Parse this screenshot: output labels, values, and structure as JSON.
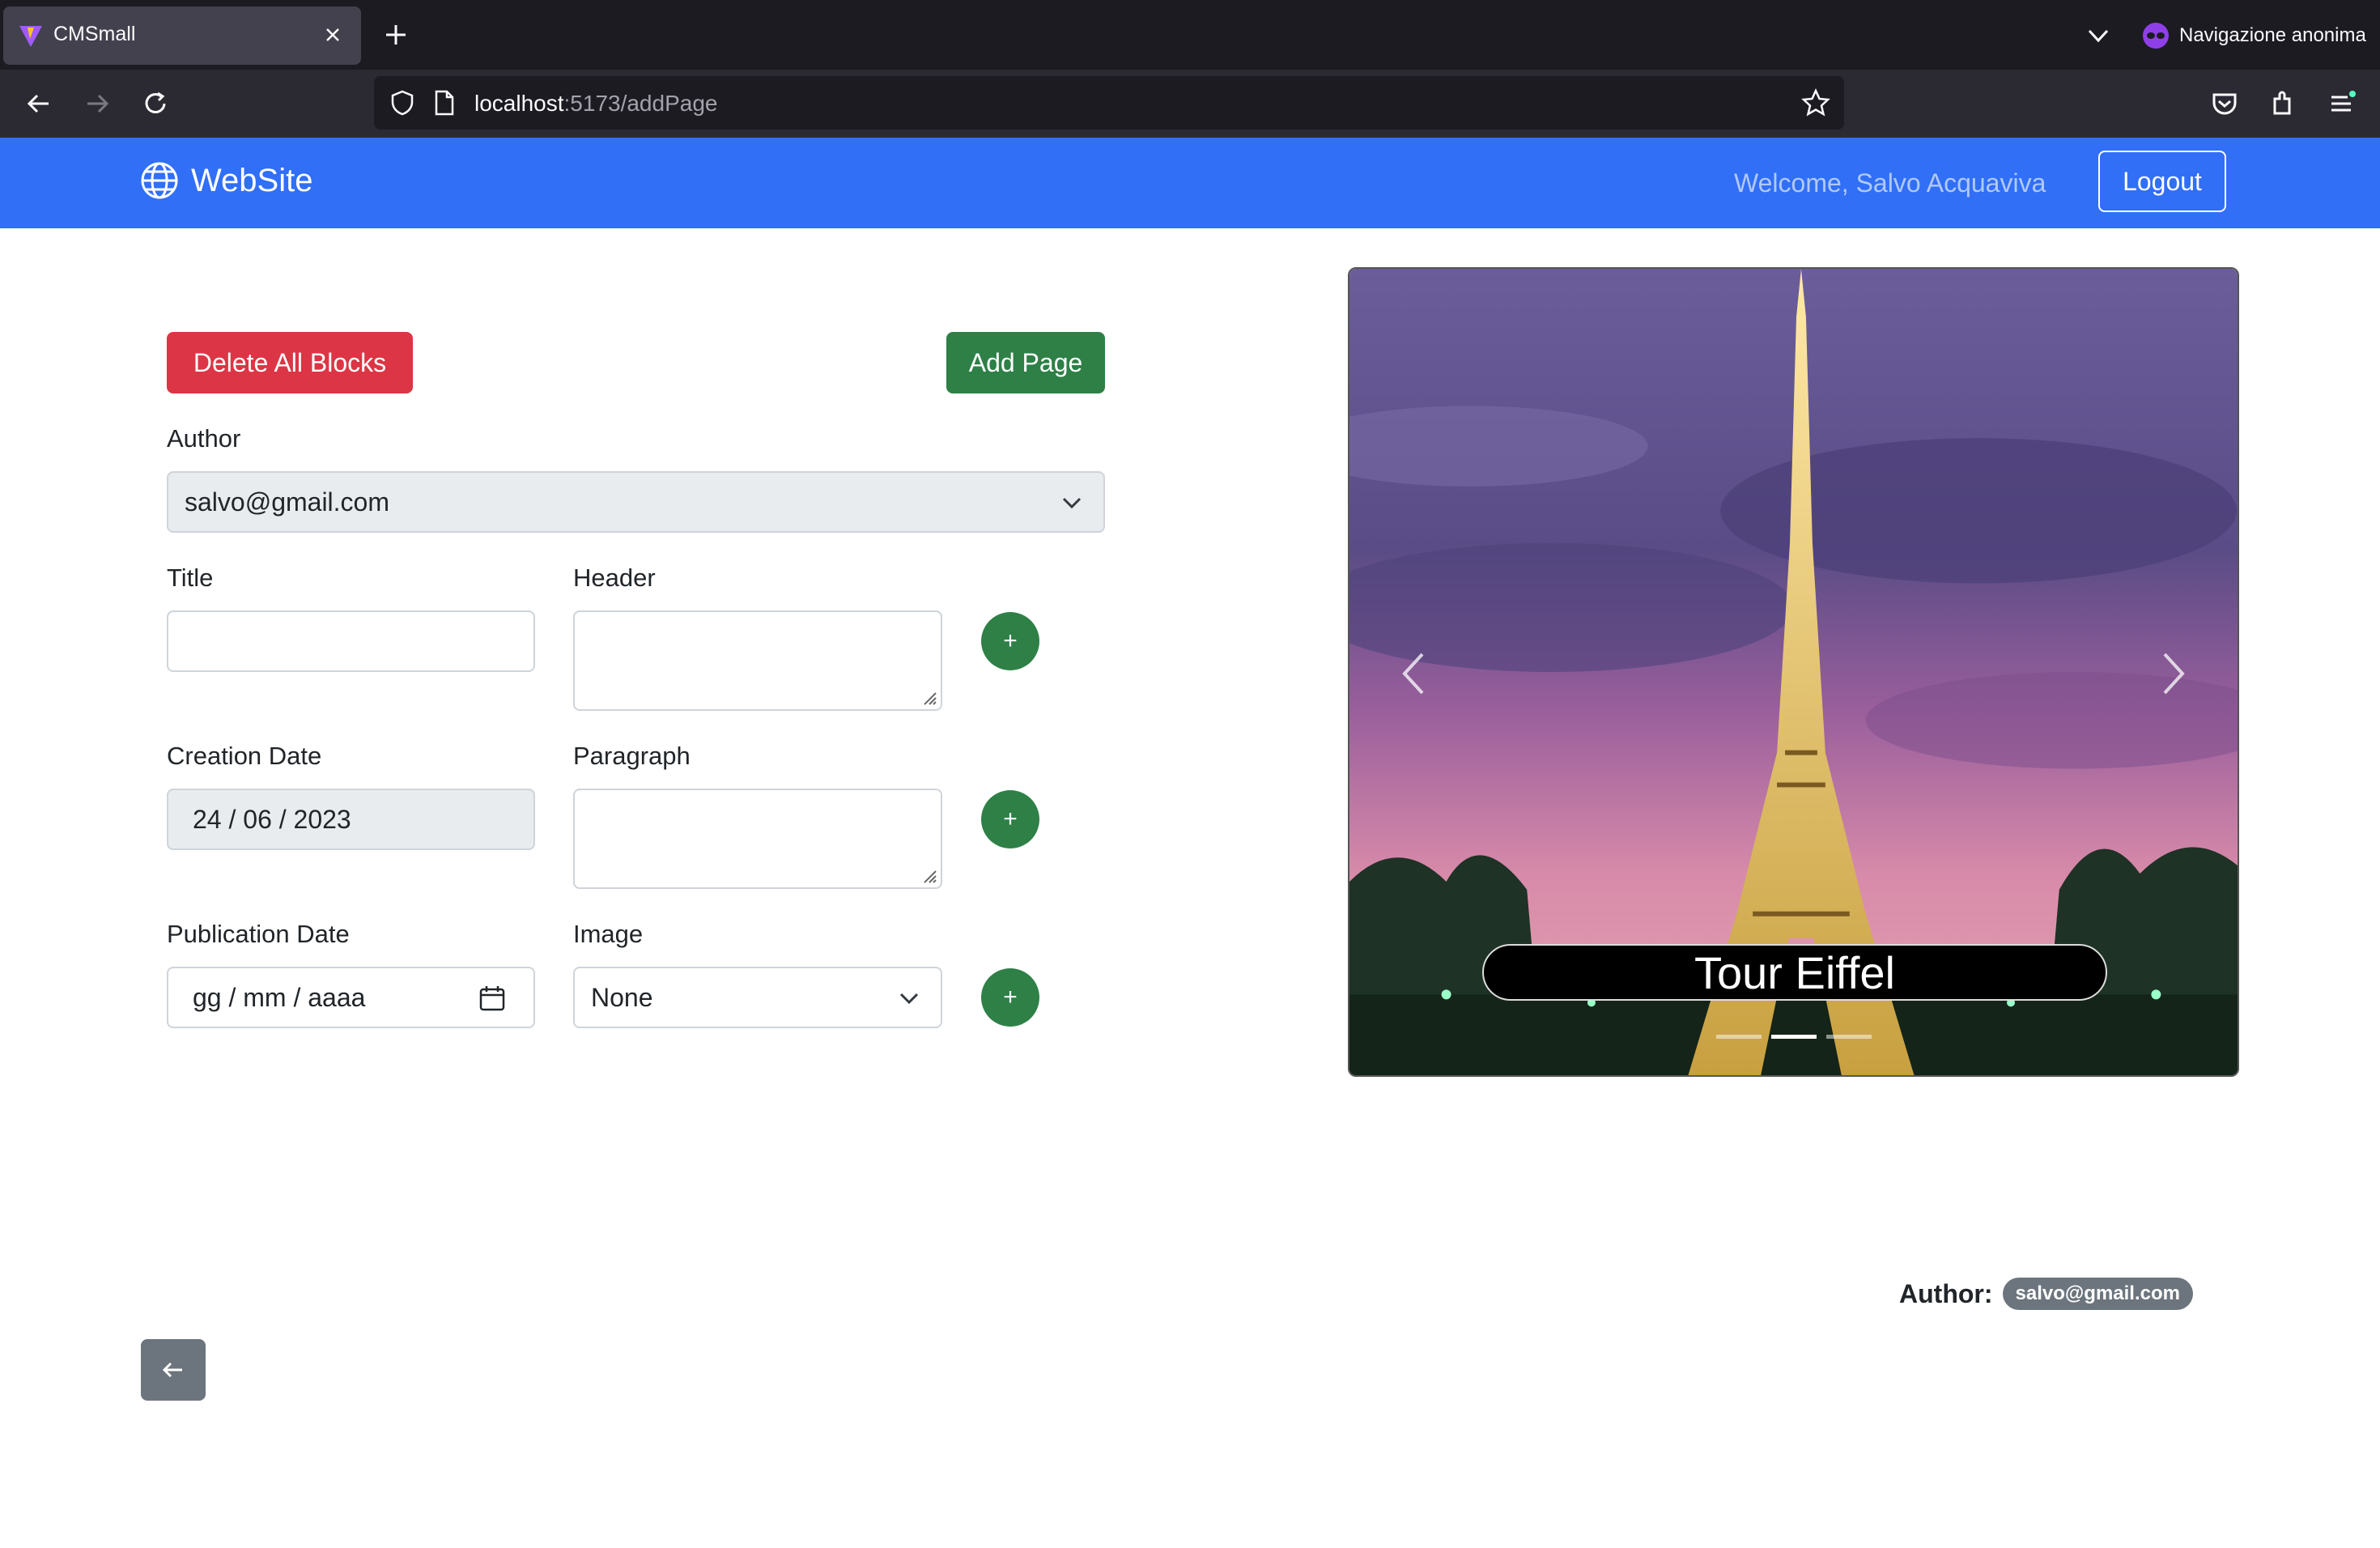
{
  "browser": {
    "tab_title": "CMSmall",
    "url_host": "localhost",
    "url_rest": ":5173/addPage",
    "private_label": "Navigazione anonima"
  },
  "navbar": {
    "brand": "WebSite",
    "welcome": "Welcome, Salvo Acquaviva",
    "logout_label": "Logout"
  },
  "form": {
    "delete_all_label": "Delete All Blocks",
    "add_page_label": "Add Page",
    "author_label": "Author",
    "author_value": "salvo@gmail.com",
    "title_label": "Title",
    "title_value": "",
    "header_label": "Header",
    "creation_date_label": "Creation Date",
    "creation_date_value": "24 / 06 / 2023",
    "paragraph_label": "Paragraph",
    "publication_date_label": "Publication Date",
    "publication_date_placeholder": "gg / mm / aaaa",
    "image_label": "Image",
    "image_value": "None",
    "add_block_symbol": "+"
  },
  "carousel": {
    "caption": "Tour Eiffel",
    "slide_count": 3,
    "active_slide": 1
  },
  "footer": {
    "author_label": "Author:",
    "author_badge": "salvo@gmail.com"
  },
  "colors": {
    "navbar": "#306ff6",
    "danger": "#dc3545",
    "success": "#2e8047",
    "secondary": "#6c757d"
  }
}
